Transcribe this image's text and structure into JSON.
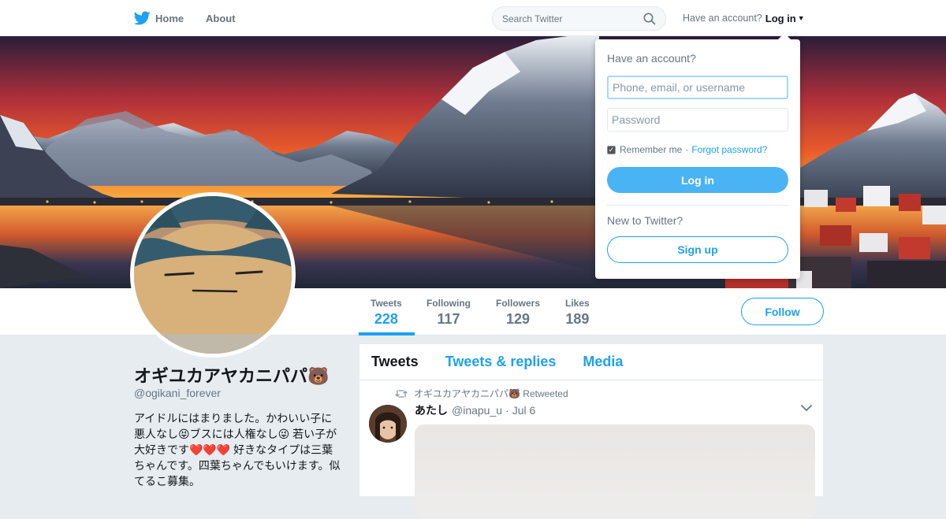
{
  "topbar": {
    "home_label": "Home",
    "about_label": "About",
    "search_placeholder": "Search Twitter",
    "account_prompt": "Have an account?",
    "login_label": "Log in"
  },
  "profile": {
    "name": "オギユカアヤカニパパ🐻",
    "handle": "@ogikani_forever",
    "bio": "アイドルにはまりました。かわいい子に悪人なし😝ブスには人権なし😜 若い子が大好きです❤️❤️❤️ 好きなタイプは三葉ちゃんです。四葉ちゃんでもいけます。似てるこ募集。",
    "follow_label": "Follow"
  },
  "stats": [
    {
      "label": "Tweets",
      "value": "228"
    },
    {
      "label": "Following",
      "value": "117"
    },
    {
      "label": "Followers",
      "value": "129"
    },
    {
      "label": "Likes",
      "value": "189"
    }
  ],
  "timeline": {
    "tabs": [
      "Tweets",
      "Tweets & replies",
      "Media"
    ],
    "retweet_line": "オギユカアヤカニパパ🐻 Retweeted",
    "tweet": {
      "name": "あたし",
      "handle": "@inapu_u",
      "separator": "·",
      "time": "Jul 6"
    }
  },
  "login_dropdown": {
    "title": "Have an account?",
    "username_placeholder": "Phone, email, or username",
    "password_placeholder": "Password",
    "remember_label": "Remember me",
    "separator": "·",
    "forgot_label": "Forgot password?",
    "login_button": "Log in",
    "new_prompt": "New to Twitter?",
    "signup_button": "Sign up"
  },
  "colors": {
    "brand": "#1da1f2",
    "background": "#e6ecf0"
  }
}
